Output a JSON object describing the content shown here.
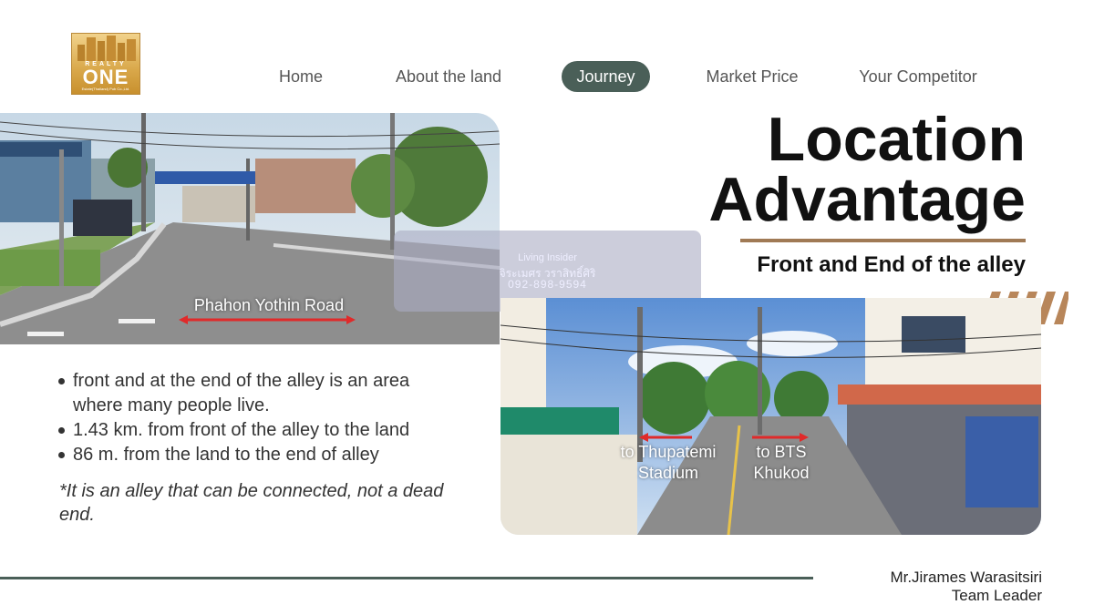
{
  "logo": {
    "word1": "REALTY",
    "word2": "ONE",
    "sub": "Estate(Thailand) Pub Co.,Ltd."
  },
  "nav": {
    "items": [
      {
        "label": "Home",
        "active": false
      },
      {
        "label": "About the land",
        "active": false
      },
      {
        "label": "Journey",
        "active": true
      },
      {
        "label": "Market Price",
        "active": false
      },
      {
        "label": "Your Competitor",
        "active": false
      }
    ]
  },
  "heading": {
    "line1": "Location",
    "line2": "Advantage",
    "subtitle": "Front and End of the alley"
  },
  "photo_road": {
    "label": "Phahon Yothin Road"
  },
  "photo_alley": {
    "label_left": "to Thupatemi Stadium",
    "label_right": "to BTS Khukod"
  },
  "watermark": {
    "brand": "Living Insider",
    "name": "จิระเมศร วราสิทธิ์ศิริ",
    "phone": "092-898-9594"
  },
  "bullets": [
    "front and at the end of the alley is an area where many people live.",
    "1.43 km. from front of the alley to the land",
    "86 m. from the land to the end of alley"
  ],
  "note": "*It is an alley that can be connected, not a dead end.",
  "author": {
    "name": "Mr.Jirames Warasitsiri",
    "role": "Team Leader"
  },
  "colors": {
    "accent": "#4a5f58",
    "brown": "#a07a55",
    "gold": "#d9a84a"
  }
}
